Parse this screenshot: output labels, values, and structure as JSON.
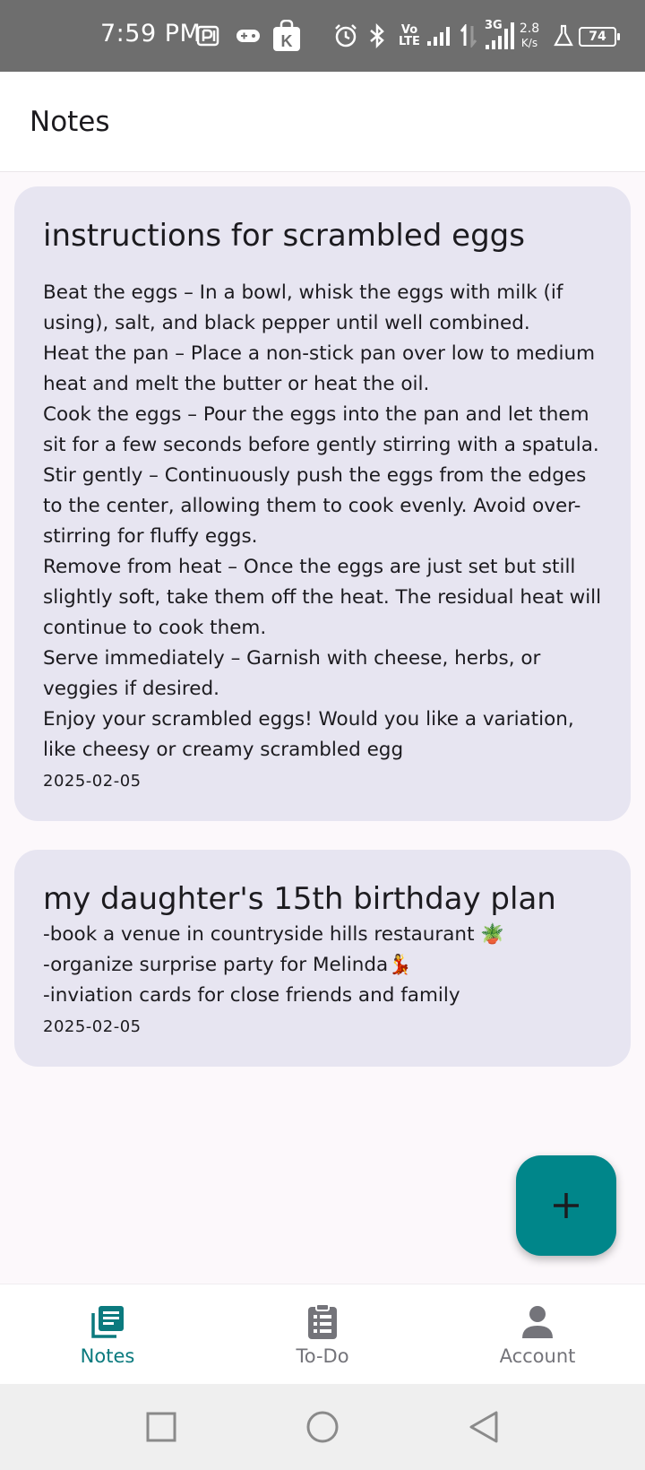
{
  "status_bar": {
    "time": "7:59 PM",
    "network_speed_value": "2.8",
    "network_speed_unit": "K/s",
    "network_type": "3G",
    "volte_top": "Vo",
    "volte_bottom": "LTE",
    "battery_level": "74",
    "icons": [
      "play-store-icon",
      "gamepad-icon",
      "k-app-icon",
      "alarm-icon",
      "bluetooth-icon",
      "volte-icon",
      "signal-icon",
      "signal-icon",
      "flask-icon",
      "battery-icon"
    ]
  },
  "app_bar": {
    "title": "Notes"
  },
  "notes": [
    {
      "title": "instructions for scrambled eggs",
      "body": "Beat the eggs – In a bowl, whisk the eggs with milk (if using), salt, and black pepper until well combined.\nHeat the pan – Place a non-stick pan over low to medium heat and melt the butter or heat the oil.\nCook the eggs – Pour the eggs into the pan and let them sit for a few seconds before gently stirring with a spatula.\nStir gently – Continuously push the eggs from the edges to the center, allowing them to cook evenly. Avoid over-stirring for fluffy eggs.\nRemove from heat – Once the eggs are just set but still slightly soft, take them off the heat. The residual heat will continue to cook them.\nServe immediately – Garnish with cheese, herbs, or veggies if desired.\nEnjoy your scrambled eggs! Would you like a variation, like cheesy or creamy scrambled egg",
      "date": "2025-02-05"
    },
    {
      "title": "my daughter's 15th  birthday plan",
      "body": "-book a venue in countryside hills restaurant 🪴\n-organize surprise party for Melinda💃\n-inviation cards for close friends and family",
      "date": "2025-02-05"
    }
  ],
  "fab": {
    "icon": "plus-icon",
    "symbol": "+"
  },
  "bottom_nav": {
    "items": [
      {
        "label": "Notes",
        "icon": "notes-icon",
        "active": true
      },
      {
        "label": "To-Do",
        "icon": "clipboard-icon",
        "active": false
      },
      {
        "label": "Account",
        "icon": "person-icon",
        "active": false
      }
    ]
  },
  "colors": {
    "accent": "#00868a",
    "card_background": "#e7e5f1",
    "active_nav": "#0b7a7e",
    "inactive_nav": "#74747a"
  }
}
